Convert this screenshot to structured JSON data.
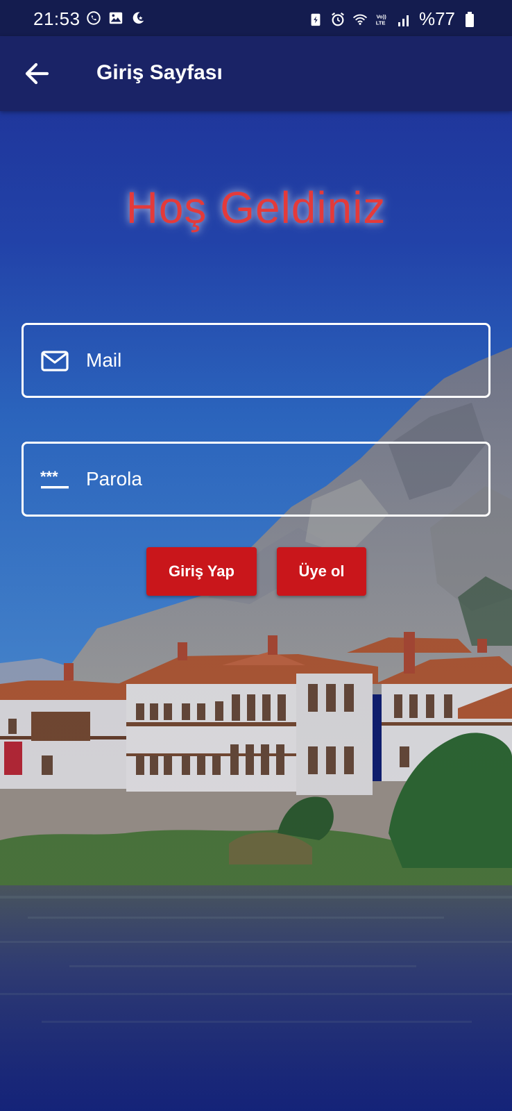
{
  "status_bar": {
    "time": "21:53",
    "battery_text": "%77",
    "left_icons": [
      "whatsapp-icon",
      "gallery-icon",
      "moon-icon"
    ],
    "right_icons": [
      "battery-saver-icon",
      "alarm-icon",
      "wifi-icon",
      "volte-icon",
      "signal-icon",
      "battery-icon"
    ]
  },
  "app_bar": {
    "title": "Giriş Sayfası",
    "back_icon": "arrow-left-icon"
  },
  "content": {
    "welcome": "Hoş Geldiniz",
    "mail_placeholder": "Mail",
    "password_placeholder": "Parola",
    "login_label": "Giriş Yap",
    "signup_label": "Üye ol"
  },
  "colors": {
    "status_bar": "#141c4f",
    "app_bar": "#1a2366",
    "welcome_text": "#e43a3a",
    "button": "#c9161b",
    "field_border": "#ffffff"
  }
}
